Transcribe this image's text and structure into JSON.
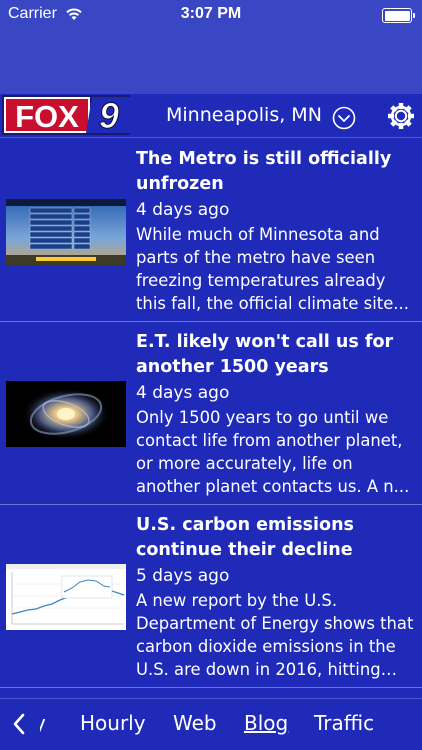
{
  "status_bar": {
    "carrier": "Carrier",
    "time": "3:07 PM"
  },
  "header": {
    "logo_text": "FOX",
    "logo_number": "9",
    "location": "Minneapolis, MN"
  },
  "articles": [
    {
      "title": "The Metro is still officially unfrozen",
      "date": "4 days ago",
      "body": "While much of Minnesota and parts of the metro have seen freezing temperatures already this fall, the official climate site..."
    },
    {
      "title": "E.T. likely won't call us for another 1500 years",
      "date": "4 days ago",
      "body": "Only 1500 years to go until we contact life from another planet, or more accurately, life on another planet contacts us.  A n..."
    },
    {
      "title": "U.S. carbon emissions continue their decline",
      "date": "5 days ago",
      "body": "A new report by the U.S. Department of Energy shows that carbon dioxide emissions in the U.S. are down in 2016, hitting th..."
    }
  ],
  "tabs": {
    "partial": "y",
    "items": [
      "Hourly",
      "Web",
      "Blog",
      "Traffic"
    ],
    "active": "Blog"
  },
  "colors": {
    "background": "#1f2bb8",
    "nav": "#3a47c4",
    "text": "#ffffff"
  }
}
